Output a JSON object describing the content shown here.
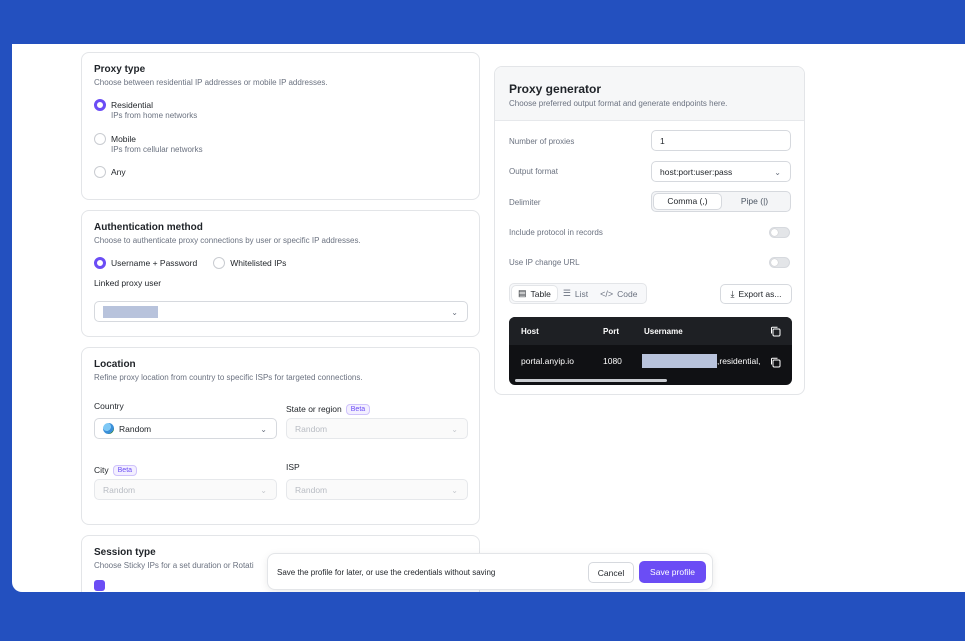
{
  "proxy_type": {
    "title": "Proxy type",
    "subtitle": "Choose between residential IP addresses or mobile IP addresses.",
    "options": [
      {
        "label": "Residential",
        "desc": "IPs from home networks",
        "selected": true
      },
      {
        "label": "Mobile",
        "desc": "IPs from cellular networks",
        "selected": false
      },
      {
        "label": "Any",
        "desc": "",
        "selected": false
      }
    ]
  },
  "auth": {
    "title": "Authentication method",
    "subtitle": "Choose to authenticate proxy connections by user or specific IP addresses.",
    "options": [
      {
        "label": "Username + Password",
        "selected": true
      },
      {
        "label": "Whitelisted IPs",
        "selected": false
      }
    ],
    "linked_user_label": "Linked proxy user"
  },
  "location": {
    "title": "Location",
    "subtitle": "Refine proxy location from country to specific ISPs for targeted connections.",
    "country_label": "Country",
    "country_value": "Random",
    "state_label": "State or region",
    "state_badge": "Beta",
    "state_placeholder": "Random",
    "city_label": "City",
    "city_badge": "Beta",
    "city_placeholder": "Random",
    "isp_label": "ISP",
    "isp_placeholder": "Random"
  },
  "session": {
    "title": "Session type",
    "subtitle": "Choose Sticky IPs for a set duration or Rotati"
  },
  "save_bar": {
    "message": "Save the profile for later, or use the credentials without saving",
    "cancel": "Cancel",
    "save": "Save profile"
  },
  "generator": {
    "title": "Proxy generator",
    "subtitle": "Choose preferred output format and generate endpoints here.",
    "num_label": "Number of proxies",
    "num_value": "1",
    "format_label": "Output format",
    "format_value": "host:port:user:pass",
    "delimiter_label": "Delimiter",
    "delimiter_options": [
      "Comma (,)",
      "Pipe (|)"
    ],
    "protocol_label": "Include protocol in records",
    "ipchange_label": "Use IP change URL",
    "views": [
      {
        "label": "Table",
        "icon": "▤"
      },
      {
        "label": "List",
        "icon": "☰"
      },
      {
        "label": "Code",
        "icon": "</>"
      }
    ],
    "export_label": "Export as...",
    "table": {
      "headers": [
        "Host",
        "Port",
        "Username"
      ],
      "row": {
        "host": "portal.anyip.io",
        "port": "1080",
        "username_suffix": ",residential,"
      }
    }
  },
  "colors": {
    "accent": "#6b4df5",
    "band": "#2350bf"
  }
}
